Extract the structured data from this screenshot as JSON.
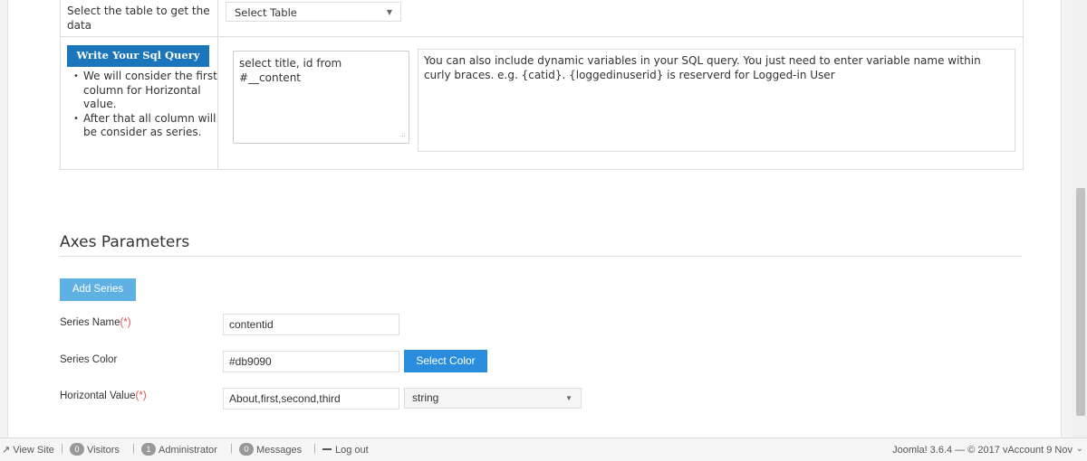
{
  "query": {
    "table_label": "Select the table to get the data",
    "table_select": "Select Table",
    "sql_button": "Write Your Sql Query",
    "hints": [
      "We will consider the first column for Horizontal value.",
      "After that all column will be consider as series."
    ],
    "sql_text": "select title, id from #__content",
    "info_text": "You can also include dynamic variables in your SQL query. You just need to enter variable name within curly braces. e.g. {catid}. {loggedinuserid} is reserverd for Logged-in User"
  },
  "axes": {
    "title": "Axes Parameters",
    "add_series": "Add Series",
    "series_name_label": "Series Name",
    "series_name_value": "contentid",
    "series_color_label": "Series Color",
    "series_color_value": "#db9090",
    "select_color": "Select Color",
    "horizontal_label": "Horizontal Value",
    "horizontal_value": "About,first,second,third",
    "horizontal_type": "string",
    "required_mark": "(*)"
  },
  "statusbar": {
    "view_site": "View Site",
    "visitors_count": "0",
    "visitors": "Visitors",
    "admin_count": "1",
    "administrator": "Administrator",
    "messages_count": "0",
    "messages": "Messages",
    "logout": "Log out",
    "version": "Joomla! 3.6.4 — © 2017 vAccount 9 Nov"
  },
  "colors": {
    "primary_button": "#1b75bb",
    "add_series_button": "#5fb0e3",
    "select_color_button": "#2a8cdc",
    "required": "#d9534f"
  }
}
